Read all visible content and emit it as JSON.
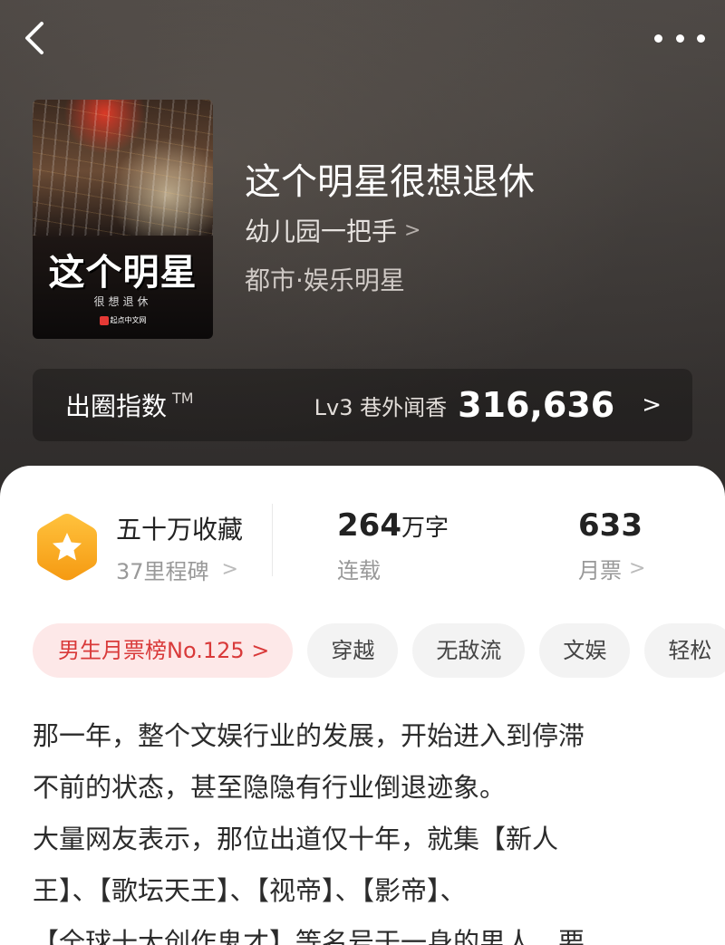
{
  "nav": {
    "back_icon": "chevron-left-icon",
    "more_icon": "more-dots-icon"
  },
  "cover": {
    "title": "这个明星",
    "subtitle": "很想退休",
    "publisher": "起点中文网"
  },
  "book": {
    "title": "这个明星很想退休",
    "author": "幼儿园一把手",
    "author_chevron": ">",
    "genre": "都市·娱乐明星"
  },
  "index_bar": {
    "label": "出圈指数",
    "tm": "TM",
    "level": "Lv3 巷外闻香",
    "score": "316,636",
    "chevron": ">"
  },
  "stats": {
    "collect": {
      "title": "五十万收藏",
      "sub": "37里程碑",
      "chevron": ">"
    },
    "words": {
      "num": "264",
      "unit": "万字",
      "sub": "连载"
    },
    "ticket": {
      "num": "633",
      "sub": "月票",
      "chevron": ">"
    }
  },
  "tags": [
    {
      "label": "男生月票榜No.125 >"
    },
    {
      "label": "穿越"
    },
    {
      "label": "无敌流"
    },
    {
      "label": "文娱"
    },
    {
      "label": "轻松"
    }
  ],
  "synopsis": "那一年，整个文娱行业的发展，开始进入到停滞\n不前的状态，甚至隐隐有行业倒退迹象。\n大量网友表示，那位出道仅十年，就集【新人\n王】、【歌坛天王】、【视帝】、【影帝】、\n【全球十大创作鬼才】等名号于一身的男人，要",
  "colors": {
    "accent_red": "#d93a3a",
    "rank_tag_bg": "#fde8e8",
    "badge_orange": "#f6a623"
  }
}
